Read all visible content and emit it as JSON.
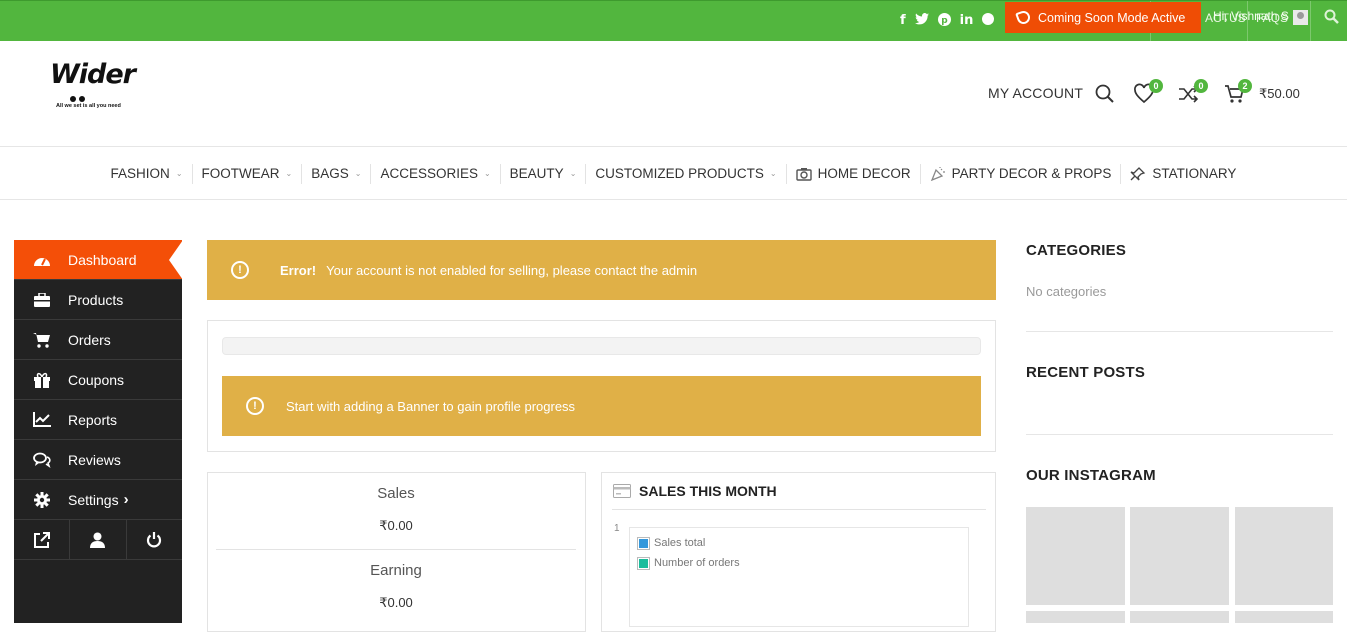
{
  "topbar": {
    "social": [
      "f",
      "t",
      "p",
      "in",
      "m"
    ],
    "coming_soon": "Coming Soon Mode Active",
    "contact_text": "ACTUS",
    "greeting": "Hi, Vishnath S",
    "faqs": "FAQS"
  },
  "header": {
    "logo_text": "Wider",
    "logo_tagline": "All we set is all you need",
    "my_account": "MY ACCOUNT",
    "wishlist_count": "0",
    "compare_count": "0",
    "cart_count": "2",
    "cart_total": "₹50.00"
  },
  "nav": {
    "items": [
      {
        "label": "FASHION",
        "dropdown": true
      },
      {
        "label": "FOOTWEAR",
        "dropdown": true
      },
      {
        "label": "BAGS",
        "dropdown": true
      },
      {
        "label": "ACCESSORIES",
        "dropdown": true
      },
      {
        "label": "BEAUTY",
        "dropdown": true
      },
      {
        "label": "CUSTOMIZED PRODUCTS",
        "dropdown": true
      },
      {
        "label": "HOME DECOR",
        "icon": "camera-icon"
      },
      {
        "label": "PARTY DECOR & PROPS",
        "icon": "party-icon"
      },
      {
        "label": "STATIONARY",
        "icon": "pin-icon"
      }
    ]
  },
  "sidebar": {
    "items": [
      {
        "label": "Dashboard",
        "icon": "dashboard-icon"
      },
      {
        "label": "Products",
        "icon": "briefcase-icon"
      },
      {
        "label": "Orders",
        "icon": "cart-icon"
      },
      {
        "label": "Coupons",
        "icon": "gift-icon"
      },
      {
        "label": "Reports",
        "icon": "chart-icon"
      },
      {
        "label": "Reviews",
        "icon": "comments-icon"
      },
      {
        "label": "Settings",
        "icon": "gear-icon"
      }
    ],
    "settings_arrow": "›"
  },
  "alerts": {
    "error_strong": "Error!",
    "error_text": "Your account is not enabled for selling, please contact the admin",
    "progress_text": "Start with adding a Banner to gain profile progress"
  },
  "stats": {
    "sales_label": "Sales",
    "sales_value": "₹0.00",
    "earning_label": "Earning",
    "earning_value": "₹0.00"
  },
  "sales_month": {
    "title": "SALES THIS MONTH",
    "axis_tick": "1",
    "legend": [
      {
        "label": "Sales total",
        "color": "#3498db"
      },
      {
        "label": "Number of orders",
        "color": "#1abc9c"
      }
    ]
  },
  "widgets": {
    "categories_title": "CATEGORIES",
    "categories_empty": "No categories",
    "recent_posts_title": "RECENT POSTS",
    "instagram_title": "OUR INSTAGRAM"
  },
  "colors": {
    "topbar": "#52b63e",
    "accent": "#f44f08",
    "alert": "#e0b047",
    "sidebar": "#222222"
  }
}
